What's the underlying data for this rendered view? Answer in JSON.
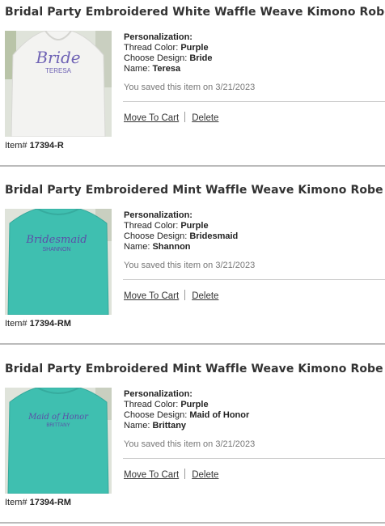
{
  "labels": {
    "personalization": "Personalization:",
    "thread_color": "Thread Color:",
    "choose_design": "Choose Design:",
    "name": "Name:",
    "item_no": "Item#",
    "move_to_cart": "Move To Cart",
    "delete": "Delete"
  },
  "items": [
    {
      "title": "Bridal Party Embroidered White Waffle Weave Kimono Robe",
      "thread_color": "Purple",
      "design": "Bride",
      "name": "Teresa",
      "saved_text": "You saved this item on 3/21/2023",
      "item_number": "17394-R",
      "robe_color": "#f3f3f1",
      "embroidery_script": "Bride",
      "embroidery_name": "TERESA"
    },
    {
      "title": "Bridal Party Embroidered Mint Waffle Weave Kimono Robe",
      "thread_color": "Purple",
      "design": "Bridesmaid",
      "name": "Shannon",
      "saved_text": "You saved this item on 3/21/2023",
      "item_number": "17394-RM",
      "robe_color": "#3fbfb0",
      "embroidery_script": "Bridesmaid",
      "embroidery_name": "SHANNON"
    },
    {
      "title": "Bridal Party Embroidered Mint Waffle Weave Kimono Robe",
      "thread_color": "Purple",
      "design": "Maid of Honor",
      "name": "Brittany",
      "saved_text": "You saved this item on 3/21/2023",
      "item_number": "17394-RM",
      "robe_color": "#3fbfb0",
      "embroidery_script": "Maid of Honor",
      "embroidery_name": "BRITTANY"
    }
  ]
}
